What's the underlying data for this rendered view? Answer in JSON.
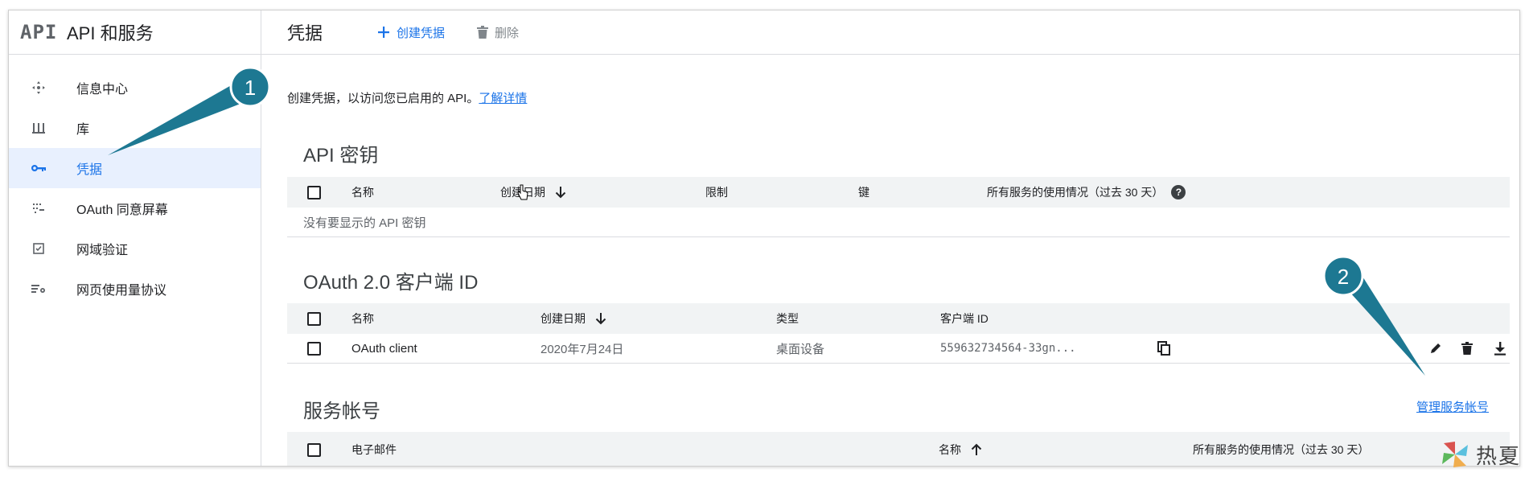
{
  "brand": {
    "logo": "API",
    "title": "API 和服务"
  },
  "sidebar": {
    "items": [
      {
        "label": "信息中心",
        "icon": "dashboard-icon"
      },
      {
        "label": "库",
        "icon": "library-icon"
      },
      {
        "label": "凭据",
        "icon": "key-icon",
        "active": true
      },
      {
        "label": "OAuth 同意屏幕",
        "icon": "consent-icon"
      },
      {
        "label": "网域验证",
        "icon": "checkbox-icon"
      },
      {
        "label": "网页使用量协议",
        "icon": "settings-list-icon"
      }
    ]
  },
  "topbar": {
    "title": "凭据",
    "create_label": "创建凭据",
    "delete_label": "删除"
  },
  "intro": {
    "text": "创建凭据，以访问您已启用的 API。",
    "link": "了解详情"
  },
  "api_keys": {
    "title": "API 密钥",
    "columns": [
      "名称",
      "创建日期",
      "限制",
      "键",
      "所有服务的使用情况（过去 30 天）"
    ],
    "empty": "没有要显示的 API 密钥"
  },
  "oauth": {
    "title": "OAuth 2.0 客户端 ID",
    "columns": [
      "名称",
      "创建日期",
      "类型",
      "客户端 ID"
    ],
    "rows": [
      {
        "name": "OAuth client",
        "date": "2020年7月24日",
        "type": "桌面设备",
        "client_id": "559632734564-33gn..."
      }
    ]
  },
  "service_accounts": {
    "title": "服务帐号",
    "manage_link": "管理服务帐号",
    "columns": [
      "电子邮件",
      "名称",
      "所有服务的使用情况（过去 30 天）"
    ]
  },
  "annotations": {
    "one": "1",
    "two": "2"
  },
  "watermark": {
    "text": "热夏"
  },
  "colors": {
    "accent": "#1a73e8",
    "annotation": "#1d7892",
    "header_bg": "#f1f3f4",
    "active_bg": "#e8f0fe"
  }
}
